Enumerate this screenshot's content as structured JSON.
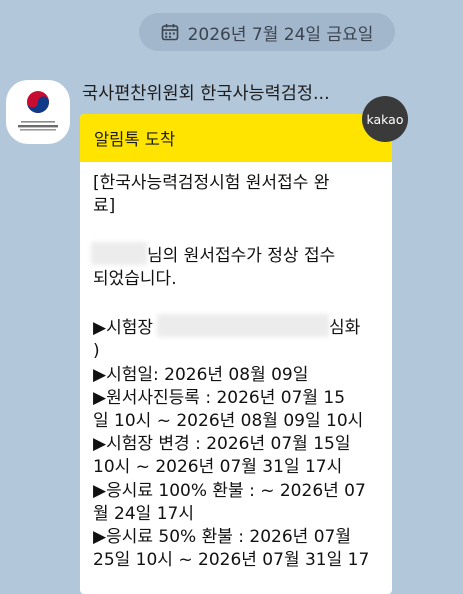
{
  "date_divider": {
    "text": "2026년 7월 24일 금요일",
    "icon": "calendar-icon"
  },
  "sender": {
    "name": "국사편찬위원회 한국사능력검정...",
    "avatar_icon": "government-emblem-icon"
  },
  "message": {
    "header": "알림톡 도착",
    "badge": "kakao",
    "lines": [
      "[한국사능력검정시험 원서접수 완",
      "료]",
      "",
      "님의 원서접수가 정상 접수",
      "되었습니다.",
      "",
      "▶시험장",
      "심화",
      ")",
      "▶시험일: 2026년 08월 09일",
      "▶원서사진등록 : 2026년 07월 15",
      "일 10시 ~ 2026년 08월 09일 10시",
      "▶시험장 변경 : 2026년 07월 15일",
      "10시 ~ 2026년 07월 31일 17시",
      "▶응시료 100% 환불 : ~ 2026년 07",
      "월 24일 17시",
      "▶응시료 50% 환불 : 2026년 07월",
      "25일 10시 ~ 2026년 07월 31일 17"
    ]
  },
  "colors": {
    "background": "#b2c7da",
    "header_yellow": "#ffe400",
    "kakao_badge": "#3a3a3a"
  }
}
